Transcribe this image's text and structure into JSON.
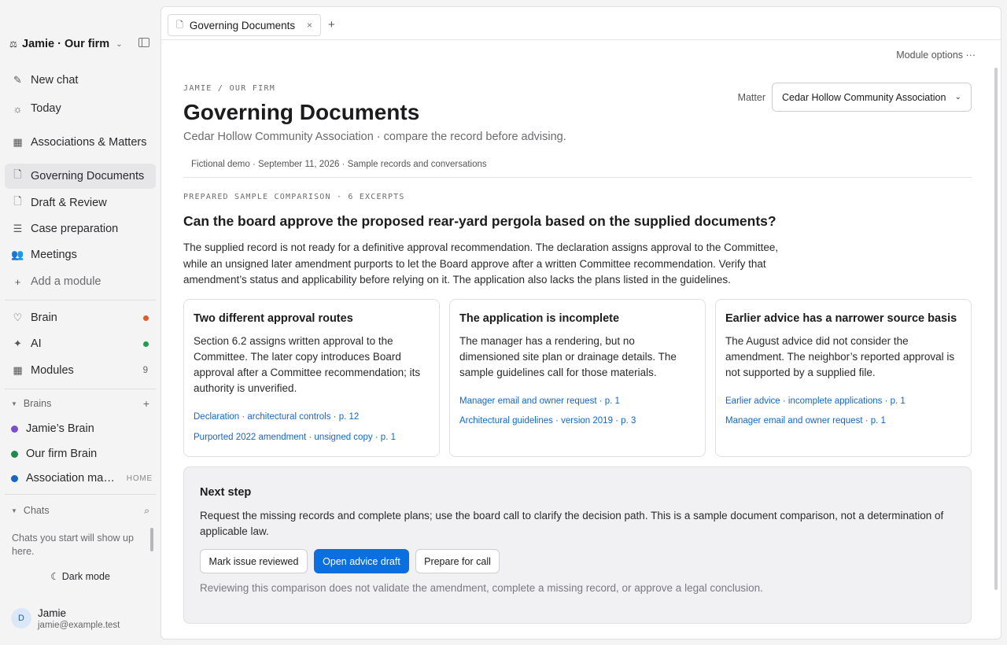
{
  "workspace": {
    "name": "Jamie · Our firm",
    "logo_icon": "scales-icon"
  },
  "sidebar": {
    "nav": [
      {
        "label": "New chat",
        "icon": "pencil-icon"
      },
      {
        "label": "Today",
        "icon": "sun-icon"
      },
      {
        "label": "Associations & Matters",
        "icon": "table-icon"
      },
      {
        "label": "Governing Documents",
        "icon": "document-icon",
        "active": true
      },
      {
        "label": "Draft & Review",
        "icon": "document-icon"
      },
      {
        "label": "Case preparation",
        "icon": "list-icon"
      },
      {
        "label": "Meetings",
        "icon": "people-icon"
      },
      {
        "label": "Add a module",
        "icon": "plus-icon"
      }
    ],
    "system": [
      {
        "label": "Brain",
        "icon": "lightbulb-icon",
        "status_color": "#e0592a"
      },
      {
        "label": "AI",
        "icon": "sparkle-icon",
        "status_color": "#1f9d4c"
      },
      {
        "label": "Modules",
        "icon": "grid-icon",
        "count": "9"
      }
    ],
    "brains_header": "Brains",
    "brains": [
      {
        "label": "Jamie’s Brain",
        "color": "#7a4fc9"
      },
      {
        "label": "Our firm Brain",
        "color": "#1f8a4c"
      },
      {
        "label": "Association management",
        "color": "#1666c5",
        "tag": "HOME"
      }
    ],
    "chats_header": "Chats",
    "chats_empty": "Chats you start will show up here.",
    "dark_mode": "Dark mode",
    "user": {
      "initial": "D",
      "name": "Jamie",
      "email": "jamie@example.test"
    }
  },
  "tabs": [
    {
      "label": "Governing Documents"
    }
  ],
  "module_options": "Module options ···",
  "page": {
    "eyebrow": "JAMIE / OUR FIRM",
    "title": "Governing Documents",
    "subtitle": "Cedar Hollow Community Association · compare the record before advising.",
    "matter_label": "Matter",
    "matter_value": "Cedar Hollow Community Association",
    "meta": "Fictional demo · September 11, 2026 · Sample records and conversations"
  },
  "comparison": {
    "eyebrow": "PREPARED SAMPLE COMPARISON · 6 EXCERPTS",
    "question": "Can the board approve the proposed rear-yard pergola based on the supplied documents?",
    "answer": "The supplied record is not ready for a definitive approval recommendation. The declaration assigns approval to the Committee, while an unsigned later amendment purports to let the Board approve after a written Committee recommendation. Verify that amendment’s status and applicability before relying on it. The application also lacks the plans listed in the guidelines.",
    "cards": [
      {
        "title": "Two different approval routes",
        "body": "Section 6.2 assigns written approval to the Committee. The later copy introduces Board approval after a Committee recommendation; its authority is unverified.",
        "sources": [
          "Declaration · architectural controls · p. 12",
          "Purported 2022 amendment · unsigned copy · p. 1"
        ]
      },
      {
        "title": "The application is incomplete",
        "body": "The manager has a rendering, but no dimensioned site plan or drainage details. The sample guidelines call for those materials.",
        "sources": [
          "Manager email and owner request · p. 1",
          "Architectural guidelines · version 2019 · p. 3"
        ]
      },
      {
        "title": "Earlier advice has a narrower source basis",
        "body": "The August advice did not consider the amendment. The neighbor’s reported approval is not supported by a supplied file.",
        "sources": [
          "Earlier advice · incomplete applications · p. 1",
          "Manager email and owner request · p. 1"
        ]
      }
    ]
  },
  "next_step": {
    "title": "Next step",
    "body": "Request the missing records and complete plans; use the board call to clarify the decision path. This is a sample document comparison, not a determination of applicable law.",
    "buttons": {
      "reviewed": "Mark issue reviewed",
      "draft": "Open advice draft",
      "call": "Prepare for call"
    },
    "note": "Reviewing this comparison does not validate the amendment, complete a missing record, or approve a legal conclusion."
  },
  "colors": {
    "accent": "#0b6fe0",
    "link": "#1666c5"
  }
}
